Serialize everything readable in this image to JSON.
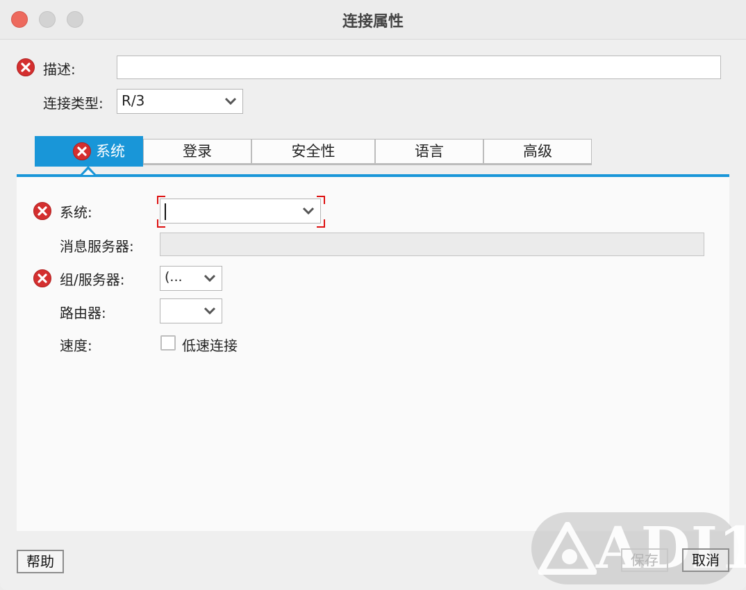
{
  "window": {
    "title": "连接属性"
  },
  "header_fields": {
    "description_label": "描述:",
    "description_value": "",
    "connection_type_label": "连接类型:",
    "connection_type_value": "R/3"
  },
  "tabs": [
    {
      "label": "系统",
      "active": true,
      "has_error": true
    },
    {
      "label": "登录",
      "active": false
    },
    {
      "label": "安全性",
      "active": false
    },
    {
      "label": "语言",
      "active": false
    },
    {
      "label": "高级",
      "active": false
    }
  ],
  "system_tab": {
    "system_label": "系统:",
    "system_value": "",
    "message_server_label": "消息服务器:",
    "message_server_value": "",
    "group_server_label": "组/服务器:",
    "group_server_value": "(...",
    "router_label": "路由器:",
    "router_value": "",
    "speed_label": "速度:",
    "low_speed_label": "低速连接",
    "low_speed_checked": false
  },
  "footer": {
    "help_label": "帮助",
    "save_label": "保存",
    "cancel_label": "取消"
  },
  "watermark": {
    "text": "ADI1"
  },
  "colors": {
    "accent": "#1996d8",
    "error": "#d42f2f",
    "close": "#ed6a5e"
  },
  "icons": {
    "error": "error-x-icon",
    "chevron": "chevron-down-icon",
    "checkbox": "checkbox-unchecked-icon"
  }
}
